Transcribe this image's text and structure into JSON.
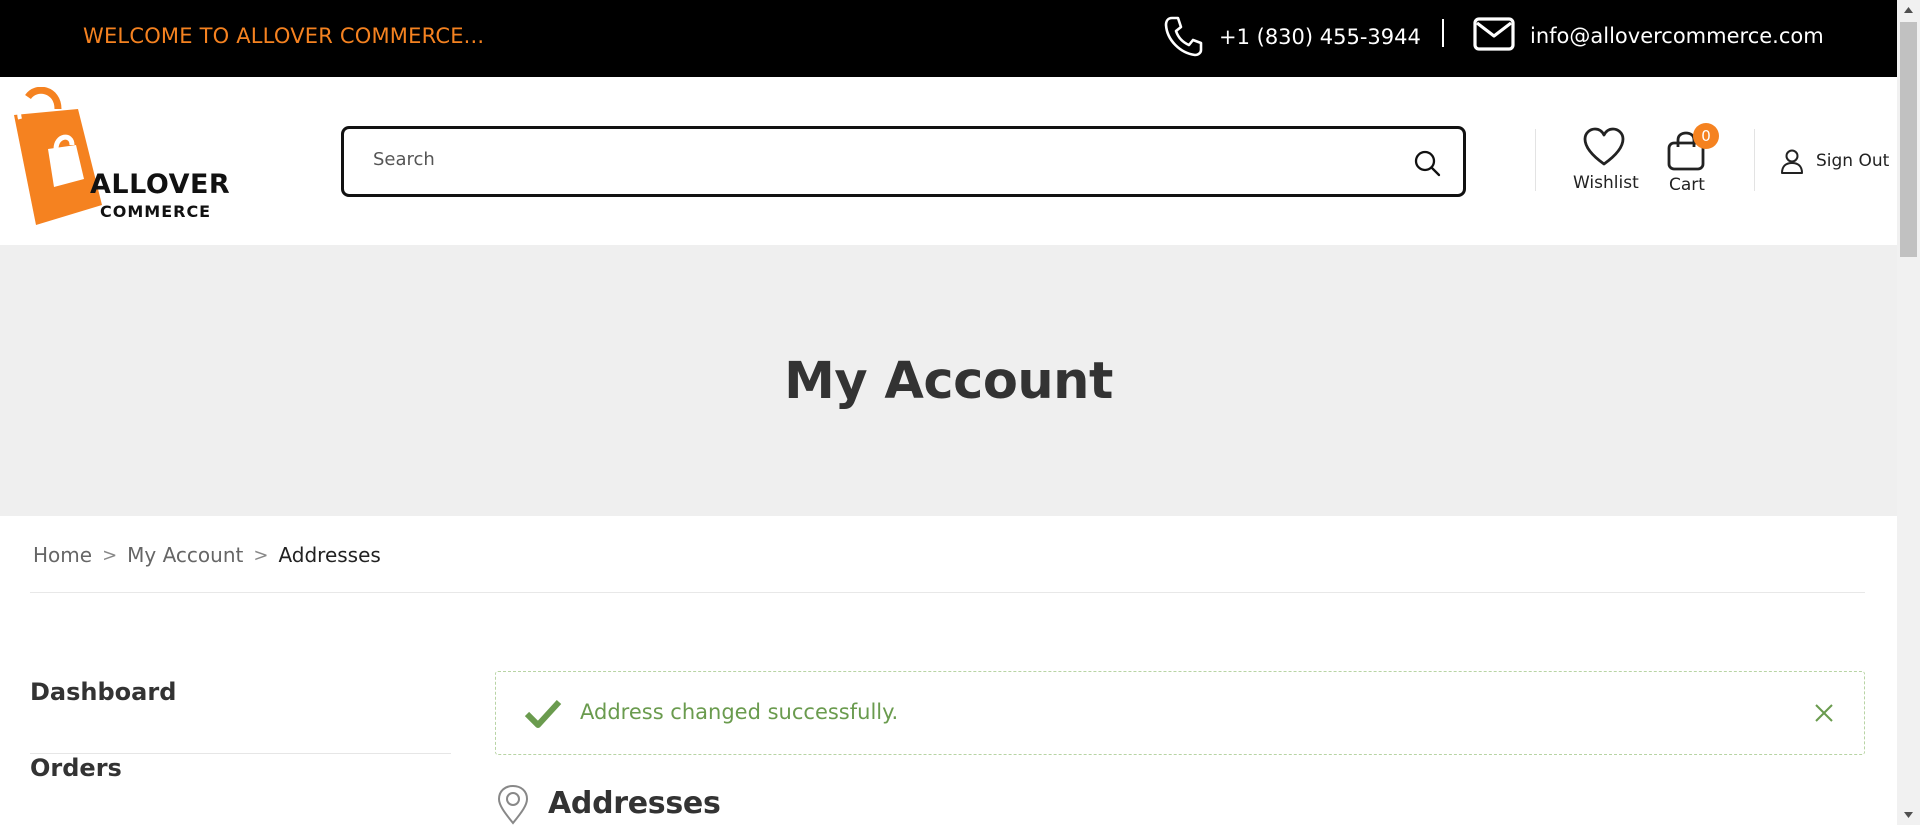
{
  "topbar": {
    "welcome": "WELCOME TO ALLOVER COMMERCE...",
    "phone": "+1 (830) 455-3944",
    "email": "info@allovercommerce.com",
    "icons": [
      "phone-icon",
      "mail-icon"
    ]
  },
  "header": {
    "logo": {
      "line1": "ALLOVER",
      "line2": "COMMERCE"
    },
    "search": {
      "placeholder": "Search",
      "value": ""
    },
    "wishlist_label": "Wishlist",
    "cart_label": "Cart",
    "cart_count": "0",
    "signout_label": "Sign Out"
  },
  "banner": {
    "title": "My Account"
  },
  "breadcrumb": {
    "items": [
      "Home",
      "My Account",
      "Addresses"
    ],
    "separator": ">"
  },
  "sidebar": {
    "items": [
      {
        "label": "Dashboard"
      },
      {
        "label": "Orders"
      }
    ]
  },
  "notice": {
    "message": "Address changed successfully.",
    "type": "success"
  },
  "section": {
    "title": "Addresses"
  },
  "colors": {
    "accent": "#f58220",
    "topbar_bg": "#000000",
    "banner_bg": "#efefef",
    "success_text": "#6a9b4e",
    "success_border": "#b8d4a4"
  }
}
